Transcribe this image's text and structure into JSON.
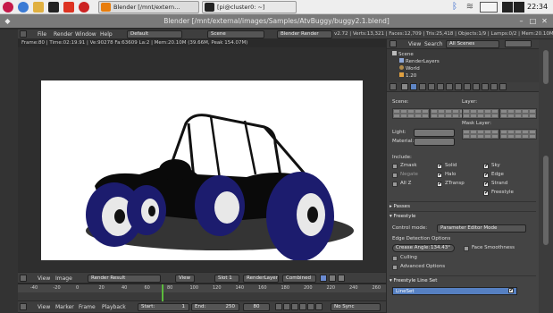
{
  "taskbar": {
    "tasks": [
      {
        "label": "Blender [/mnt/extern…",
        "icon": "blender-icon"
      },
      {
        "label": "[pi@cluster0: ~]",
        "icon": "terminal-icon"
      }
    ],
    "clock": "22:34"
  },
  "window": {
    "title": "Blender [/mnt/external/images/Samples/AtvBuggy/buggy2.1.blend]"
  },
  "info_header": {
    "menus": [
      "File",
      "Render",
      "Window",
      "Help"
    ],
    "layout": "Default",
    "scene": "Scene",
    "engine": "Blender Render",
    "stats": "v2.72 | Verts:13,321 | Faces:12,709 | Tris:25,418 | Objects:1/9 | Lamps:0/2 | Mem:20.10M | Cube"
  },
  "render_info": "Frame:80 | Time:02:19.91 | Ve:90278 Fa:63609 La:2 | Mem:20.10M (39.66M, Peak 154.07M)",
  "outliner": {
    "header": {
      "view": "View",
      "search": "Search",
      "scenes": "All Scenes"
    },
    "items": [
      "Scene",
      "RenderLayers",
      "World",
      "1.20"
    ]
  },
  "render_layers": {
    "scene_label": "Scene:",
    "layer_label": "Layer:",
    "mask_label": "Mask Layer:",
    "light_label": "Light:",
    "material_label": "Material:",
    "include_label": "Include:",
    "include_items": [
      {
        "label": "Zmask",
        "checked": false
      },
      {
        "label": "Solid",
        "checked": true
      },
      {
        "label": "Sky",
        "checked": true
      },
      {
        "label": "Negate",
        "checked": false
      },
      {
        "label": "Halo",
        "checked": true
      },
      {
        "label": "Edge",
        "checked": true
      },
      {
        "label": "All Z",
        "checked": false
      },
      {
        "label": "ZTransp",
        "checked": true
      },
      {
        "label": "Strand",
        "checked": true
      },
      {
        "label": "Freestyle",
        "checked": true
      }
    ],
    "passes": "Passes",
    "freestyle": "Freestyle",
    "control_mode_label": "Control mode:",
    "control_mode_value": "Parameter Editor Mode",
    "edge_detection": "Edge Detection Options",
    "crease_angle": "Crease Angle:",
    "crease_value": "134.43°",
    "face_smoothness": "Face Smoothness",
    "culling": "Culling",
    "advanced": "Advanced Options",
    "lineset_section": "Freestyle Line Set",
    "lineset": "LineSet"
  },
  "image_editor_header": {
    "menus": [
      "View",
      "Image"
    ],
    "image": "Render Result",
    "view": "View",
    "slot": "Slot 1",
    "layer": "RenderLayer",
    "pass": "Combined"
  },
  "timeline": {
    "ticks": [
      "-40",
      "-20",
      "0",
      "20",
      "40",
      "60",
      "80",
      "100",
      "120",
      "140",
      "160",
      "180",
      "200",
      "220",
      "240",
      "260"
    ],
    "menus": [
      "View",
      "Marker",
      "Frame",
      "Playback"
    ],
    "start": "Start:",
    "start_value": "1",
    "end": "End:",
    "end_value": "250",
    "current": "80",
    "sync": "No Sync",
    "current_frame_fraction": 0.27
  }
}
